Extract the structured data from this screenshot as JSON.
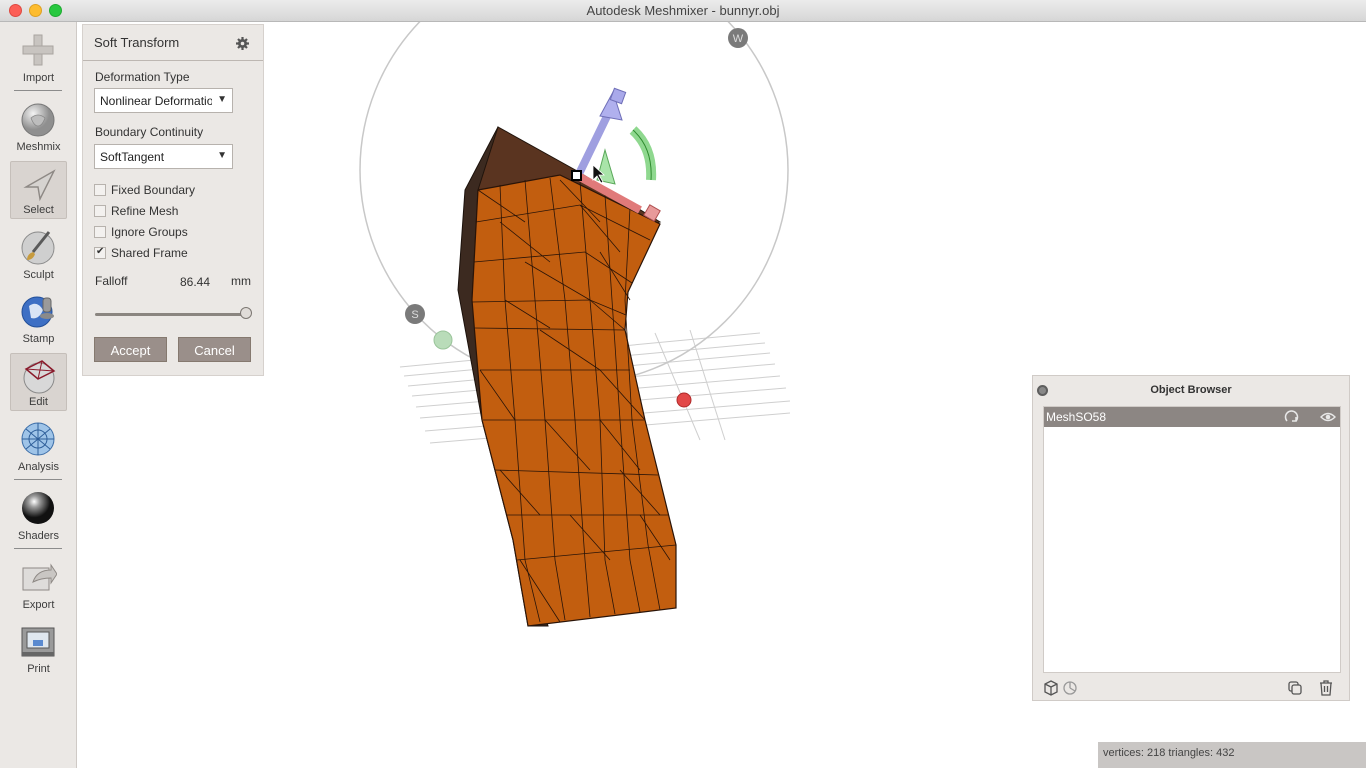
{
  "window": {
    "title": "Autodesk Meshmixer - bunnyr.obj"
  },
  "toolbar": {
    "items": [
      {
        "label": "Import",
        "icon": "plus-icon"
      },
      {
        "label": "Meshmix",
        "icon": "bunny-sphere-icon"
      },
      {
        "label": "Select",
        "icon": "cursor-arrow-icon",
        "active": true
      },
      {
        "label": "Sculpt",
        "icon": "brush-icon"
      },
      {
        "label": "Stamp",
        "icon": "stamp-icon"
      },
      {
        "label": "Edit",
        "icon": "edit-mesh-icon",
        "active": true
      },
      {
        "label": "Analysis",
        "icon": "analysis-sphere-icon"
      },
      {
        "label": "Shaders",
        "icon": "shader-sphere-icon"
      },
      {
        "label": "Export",
        "icon": "export-icon"
      },
      {
        "label": "Print",
        "icon": "printer-icon"
      }
    ]
  },
  "soft_transform": {
    "title": "Soft Transform",
    "deformation_type_label": "Deformation Type",
    "deformation_type_value": "Nonlinear Deformation",
    "boundary_continuity_label": "Boundary Continuity",
    "boundary_continuity_value": "SoftTangent",
    "options": [
      {
        "label": "Fixed Boundary",
        "checked": false
      },
      {
        "label": "Refine Mesh",
        "checked": false
      },
      {
        "label": "Ignore Groups",
        "checked": false
      },
      {
        "label": "Shared Frame",
        "checked": true
      }
    ],
    "falloff_label": "Falloff",
    "falloff_value": "86.44",
    "falloff_unit": "mm",
    "falloff_slider_fraction": 1.0,
    "accept_label": "Accept",
    "cancel_label": "Cancel"
  },
  "viewport": {
    "gizmo_labels": {
      "w": "W",
      "s": "S"
    },
    "mesh_color": "#c25e0f",
    "axis_colors": {
      "up": "#9f9fe0",
      "right": "#e07a7a",
      "rotate": "#8fd88f"
    }
  },
  "object_browser": {
    "title": "Object Browser",
    "objects": [
      {
        "name": "MeshSO58"
      }
    ]
  },
  "status": {
    "text": "vertices: 218 triangles: 432"
  }
}
